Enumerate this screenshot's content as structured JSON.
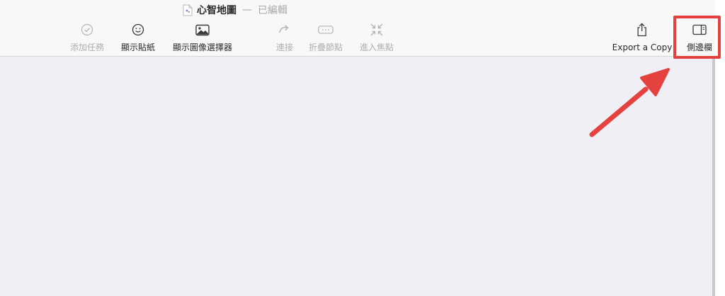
{
  "window": {
    "title": "心智地圖",
    "separator": "—",
    "status": "已編輯"
  },
  "toolbar": {
    "add_task": "添加任務",
    "show_stickers": "顯示貼紙",
    "show_image_picker": "顯示圖像選擇器",
    "connect": "連接",
    "fold_nodes": "折疊節點",
    "enter_focus": "進入焦點",
    "export_copy": "Export a Copy",
    "sidebar": "側邊欄"
  },
  "colors": {
    "highlight": "#e4413f",
    "canvas": "#f1eff6"
  }
}
